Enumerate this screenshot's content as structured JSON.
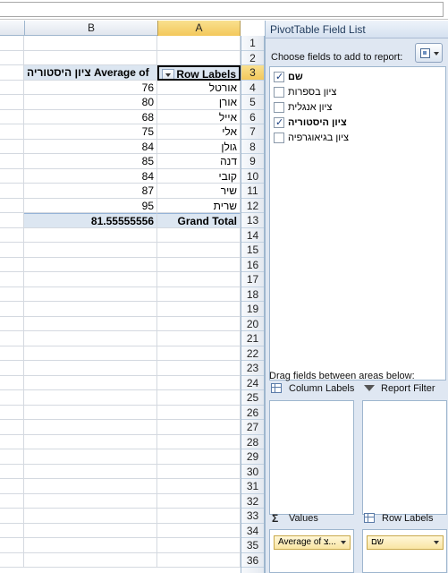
{
  "columns": {
    "left_blank": "",
    "b": "B",
    "a": "A"
  },
  "pivot": {
    "header_values": "Average of ציון היסטוריה",
    "header_rows": "Row Labels",
    "rows": [
      {
        "label": "אורטל",
        "value": "76"
      },
      {
        "label": "אורן",
        "value": "80"
      },
      {
        "label": "אייל",
        "value": "68"
      },
      {
        "label": "אלי",
        "value": "75"
      },
      {
        "label": "גולן",
        "value": "84"
      },
      {
        "label": "דנה",
        "value": "85"
      },
      {
        "label": "קובי",
        "value": "84"
      },
      {
        "label": "שיר",
        "value": "87"
      },
      {
        "label": "שרית",
        "value": "95"
      }
    ],
    "total_label": "Grand Total",
    "total_value": "81.55555556"
  },
  "row_numbers": [
    "1",
    "2",
    "3",
    "4",
    "5",
    "6",
    "7",
    "8",
    "9",
    "10",
    "11",
    "12",
    "13",
    "14",
    "15",
    "16",
    "17",
    "18",
    "19",
    "20",
    "21",
    "22",
    "23",
    "24",
    "25",
    "26",
    "27",
    "28",
    "29",
    "30",
    "31",
    "32",
    "33",
    "34",
    "35",
    "36"
  ],
  "panel": {
    "title": "PivotTable Field List",
    "choose_label": "Choose fields to add to report:",
    "fields": [
      {
        "label": "שם",
        "checked": true,
        "bold": true
      },
      {
        "label": "ציון בספרות",
        "checked": false,
        "bold": false
      },
      {
        "label": "ציון אנגלית",
        "checked": false,
        "bold": false
      },
      {
        "label": "ציון היסטוריה",
        "checked": true,
        "bold": true
      },
      {
        "label": "ציון בגיאוגרפיה",
        "checked": false,
        "bold": false
      }
    ],
    "drag_label": "Drag fields between areas below:",
    "areas": {
      "column_labels": "Column Labels",
      "report_filter": "Report Filter",
      "values": "Values",
      "row_labels": "Row Labels"
    },
    "values_chip": "Average of צ...",
    "rows_chip": "שם"
  }
}
